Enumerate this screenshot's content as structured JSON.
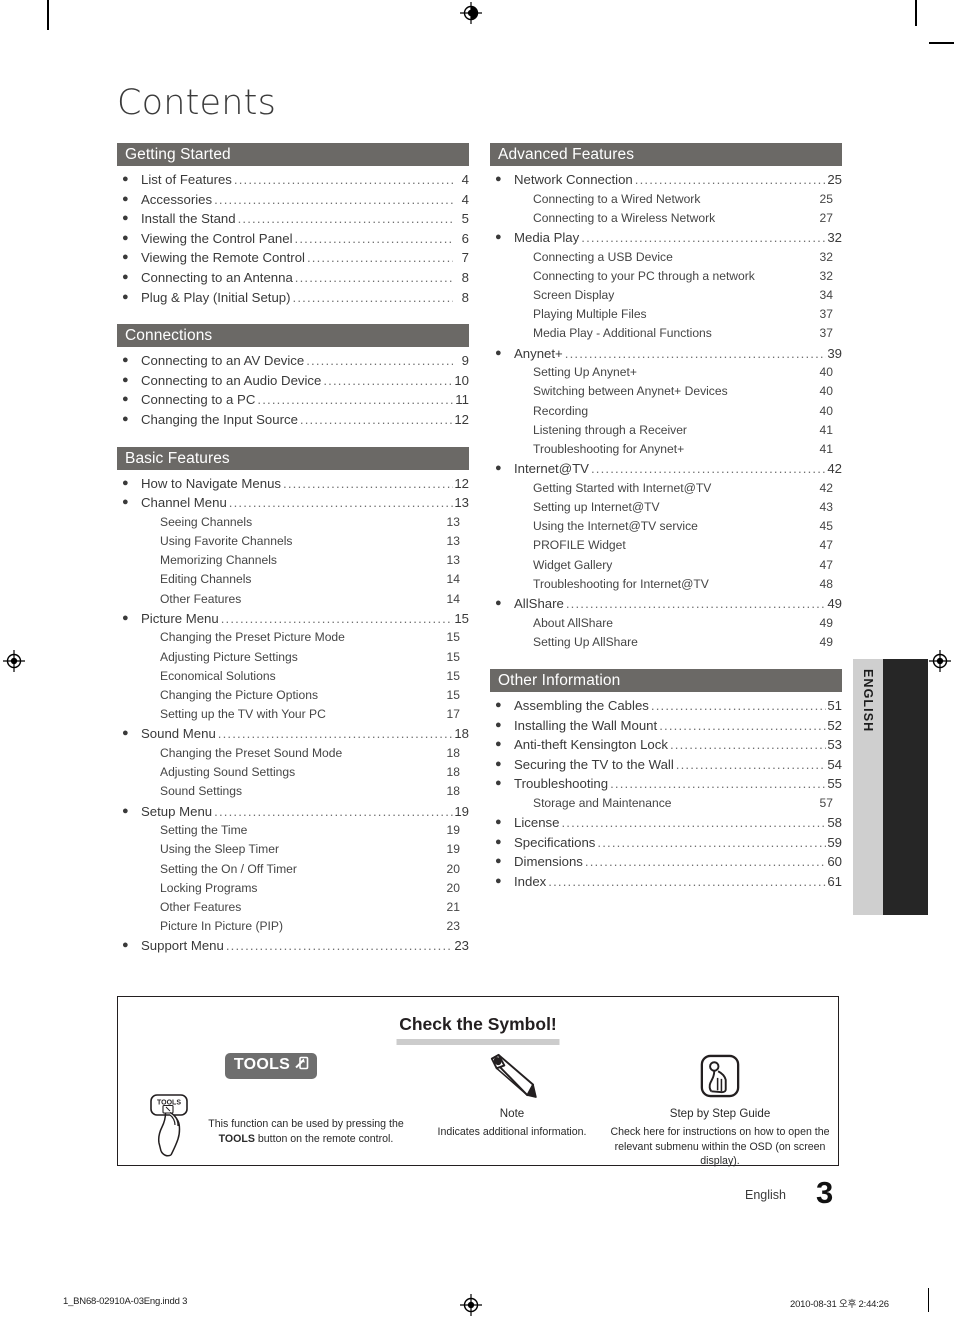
{
  "page": {
    "title": "Contents",
    "language_tab": "ENGLISH",
    "footer_language": "English",
    "footer_page_number": "3"
  },
  "toc": {
    "left_column": [
      {
        "heading": "Getting Started",
        "entries": [
          {
            "level": 1,
            "label": "List of Features",
            "page": "4"
          },
          {
            "level": 1,
            "label": "Accessories",
            "page": "4"
          },
          {
            "level": 1,
            "label": "Install the Stand",
            "page": "5"
          },
          {
            "level": 1,
            "label": "Viewing the Control Panel",
            "page": "6"
          },
          {
            "level": 1,
            "label": "Viewing the Remote Control",
            "page": "7"
          },
          {
            "level": 1,
            "label": "Connecting to an Antenna",
            "page": "8"
          },
          {
            "level": 1,
            "label": "Plug & Play (Initial Setup)",
            "page": "8"
          }
        ]
      },
      {
        "heading": "Connections",
        "entries": [
          {
            "level": 1,
            "label": "Connecting to an AV Device",
            "page": "9"
          },
          {
            "level": 1,
            "label": "Connecting to an Audio Device",
            "page": "10"
          },
          {
            "level": 1,
            "label": "Connecting to a PC",
            "page": "11"
          },
          {
            "level": 1,
            "label": "Changing the Input Source",
            "page": "12"
          }
        ]
      },
      {
        "heading": "Basic Features",
        "entries": [
          {
            "level": 1,
            "label": "How to Navigate Menus",
            "page": "12"
          },
          {
            "level": 1,
            "label": "Channel Menu",
            "page": "13"
          },
          {
            "level": 2,
            "label": "Seeing Channels",
            "page": "13"
          },
          {
            "level": 2,
            "label": "Using Favorite Channels",
            "page": "13"
          },
          {
            "level": 2,
            "label": "Memorizing Channels",
            "page": "13"
          },
          {
            "level": 2,
            "label": "Editing Channels",
            "page": "14"
          },
          {
            "level": 2,
            "label": "Other Features",
            "page": "14"
          },
          {
            "level": 1,
            "label": "Picture Menu",
            "page": "15"
          },
          {
            "level": 2,
            "label": "Changing the Preset Picture Mode",
            "page": "15"
          },
          {
            "level": 2,
            "label": "Adjusting Picture Settings",
            "page": "15"
          },
          {
            "level": 2,
            "label": "Economical Solutions",
            "page": "15"
          },
          {
            "level": 2,
            "label": "Changing the Picture Options",
            "page": "15"
          },
          {
            "level": 2,
            "label": "Setting up the TV with Your PC",
            "page": "17"
          },
          {
            "level": 1,
            "label": "Sound Menu",
            "page": "18"
          },
          {
            "level": 2,
            "label": "Changing the Preset Sound Mode",
            "page": "18"
          },
          {
            "level": 2,
            "label": "Adjusting Sound Settings",
            "page": "18"
          },
          {
            "level": 2,
            "label": "Sound Settings",
            "page": "18"
          },
          {
            "level": 1,
            "label": "Setup Menu",
            "page": "19"
          },
          {
            "level": 2,
            "label": "Setting the Time",
            "page": "19"
          },
          {
            "level": 2,
            "label": "Using the Sleep Timer",
            "page": "19"
          },
          {
            "level": 2,
            "label": "Setting the On / Off Timer",
            "page": "20"
          },
          {
            "level": 2,
            "label": "Locking Programs",
            "page": "20"
          },
          {
            "level": 2,
            "label": "Other Features",
            "page": "21"
          },
          {
            "level": 2,
            "label": "Picture In Picture (PIP)",
            "page": "23"
          },
          {
            "level": 1,
            "label": "Support Menu",
            "page": "23"
          }
        ]
      }
    ],
    "right_column": [
      {
        "heading": "Advanced Features",
        "entries": [
          {
            "level": 1,
            "label": "Network Connection",
            "page": "25"
          },
          {
            "level": 2,
            "label": "Connecting to a Wired Network",
            "page": "25"
          },
          {
            "level": 2,
            "label": "Connecting to a Wireless Network",
            "page": "27"
          },
          {
            "level": 1,
            "label": "Media Play",
            "page": "32"
          },
          {
            "level": 2,
            "label": "Connecting a USB Device",
            "page": "32"
          },
          {
            "level": 2,
            "label": "Connecting to your PC through a network",
            "page": "32"
          },
          {
            "level": 2,
            "label": "Screen Display",
            "page": "34"
          },
          {
            "level": 2,
            "label": "Playing Multiple Files",
            "page": "37"
          },
          {
            "level": 2,
            "label": "Media Play - Additional Functions",
            "page": "37"
          },
          {
            "level": 1,
            "label": "Anynet+",
            "page": "39"
          },
          {
            "level": 2,
            "label": "Setting Up Anynet+",
            "page": "40"
          },
          {
            "level": 2,
            "label": "Switching between Anynet+ Devices",
            "page": "40"
          },
          {
            "level": 2,
            "label": "Recording",
            "page": "40"
          },
          {
            "level": 2,
            "label": "Listening through a Receiver",
            "page": "41"
          },
          {
            "level": 2,
            "label": "Troubleshooting for Anynet+",
            "page": "41"
          },
          {
            "level": 1,
            "label": "Internet@TV",
            "page": "42"
          },
          {
            "level": 2,
            "label": "Getting Started with Internet@TV",
            "page": "42"
          },
          {
            "level": 2,
            "label": "Setting up Internet@TV",
            "page": "43"
          },
          {
            "level": 2,
            "label": "Using the Internet@TV service",
            "page": "45"
          },
          {
            "level": 2,
            "label": "PROFILE Widget",
            "page": "47"
          },
          {
            "level": 2,
            "label": "Widget Gallery",
            "page": "47"
          },
          {
            "level": 2,
            "label": "Troubleshooting for Internet@TV",
            "page": "48"
          },
          {
            "level": 1,
            "label": "AllShare",
            "page": "49"
          },
          {
            "level": 2,
            "label": "About AllShare",
            "page": "49"
          },
          {
            "level": 2,
            "label": "Setting Up AllShare",
            "page": "49"
          }
        ]
      },
      {
        "heading": "Other Information",
        "entries": [
          {
            "level": 1,
            "label": "Assembling the Cables",
            "page": "51"
          },
          {
            "level": 1,
            "label": "Installing the Wall Mount",
            "page": "52"
          },
          {
            "level": 1,
            "label": "Anti-theft Kensington Lock",
            "page": "53"
          },
          {
            "level": 1,
            "label": "Securing the TV to the Wall",
            "page": "54"
          },
          {
            "level": 1,
            "label": "Troubleshooting",
            "page": "55"
          },
          {
            "level": 2,
            "label": "Storage and Maintenance",
            "page": "57"
          },
          {
            "level": 1,
            "label": "License",
            "page": "58"
          },
          {
            "level": 1,
            "label": "Specifications",
            "page": "59"
          },
          {
            "level": 1,
            "label": "Dimensions",
            "page": "60"
          },
          {
            "level": 1,
            "label": "Index",
            "page": "61"
          }
        ]
      }
    ]
  },
  "symbol_box": {
    "title": "Check the Symbol!",
    "tools": {
      "badge_label": "TOOLS",
      "button_label": "TOOLS",
      "description_prefix": "This function can be used by pressing the ",
      "description_bold": "TOOLS",
      "description_suffix": " button on the remote control."
    },
    "note": {
      "caption": "Note",
      "description": "Indicates additional information."
    },
    "step_guide": {
      "caption": "Step by Step Guide",
      "description": "Check here for instructions on how to open the relevant submenu within the OSD (on screen display)."
    }
  },
  "print_footer": {
    "filename": "1_BN68-02910A-03Eng.indd   3",
    "timestamp": "2010-08-31   오후 2:44:26"
  },
  "colors": {
    "section_bar": "#6b6966",
    "tools_badge": "#6e6e6e",
    "lang_tab_light": "#cfcfcf",
    "lang_tab_dark": "#262626",
    "underline": "#cccccc"
  }
}
